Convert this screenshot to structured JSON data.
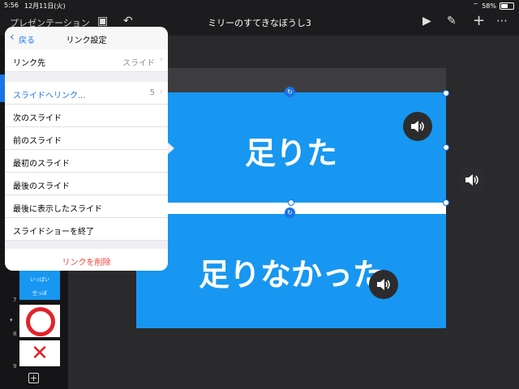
{
  "status": {
    "time": "5:56",
    "date": "12月11日(火)",
    "battery": "58%"
  },
  "toolbar": {
    "left_label": "プレゼンテーション",
    "title": "ミリーのすてきなぼうし3"
  },
  "popover": {
    "back_label": "戻る",
    "title": "リンク設定",
    "link_dest_label": "リンク先",
    "link_dest_value": "スライド",
    "items": [
      {
        "label": "スライドへリンク...",
        "value": "5"
      },
      {
        "label": "次のスライド"
      },
      {
        "label": "前のスライド"
      },
      {
        "label": "最初のスライド"
      },
      {
        "label": "最後のスライド"
      },
      {
        "label": "最後に表示したスライド"
      },
      {
        "label": "スライドショーを終了"
      }
    ],
    "remove_label": "リンクを削除"
  },
  "sidebar": {
    "thumb_text_1": "いっぱい",
    "thumb_text_2": "空っぽ",
    "nums": [
      "7",
      "8",
      "9"
    ]
  },
  "slide": {
    "top_text": "足りた",
    "bottom_text": "足りなかった"
  },
  "colors": {
    "accent": "#1a73e8",
    "slide_blue": "#1797f1",
    "destructive": "#ff3b30"
  }
}
